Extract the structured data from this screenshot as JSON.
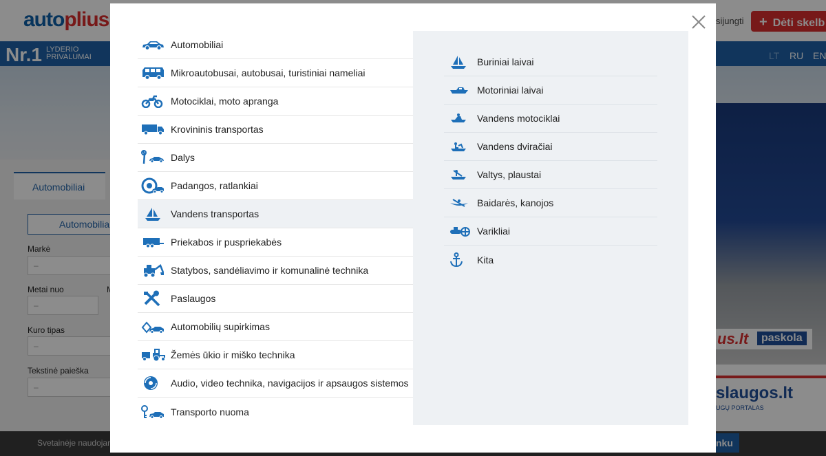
{
  "background": {
    "logo_part1": "auto",
    "logo_part2": "plius",
    "login_link": "sijungti",
    "add_ad_button": "Dėti skelb",
    "nr1": "Nr.1",
    "nr1_sub_line1": "LYDERIO",
    "nr1_sub_line2": "PRIVALUMAI",
    "languages": [
      "LT",
      "RU",
      "EN"
    ],
    "tab_automobiliai": "Automobiliai",
    "category_select": "Automobilia",
    "fields": {
      "marke_label": "Markė",
      "marke_value": "–",
      "metai_nuo_label": "Metai nuo",
      "metai_nuo_value": "–",
      "m_label": "M",
      "kuro_tipas_label": "Kuro tipas",
      "kuro_tipas_value": "–",
      "tekstine_paieska_label": "Tekstinė paieška",
      "tekstine_paieska_value": "–"
    },
    "promo_paskola_us": "us.lt",
    "promo_paskola_box": "paskola",
    "promo_paslaugos": "slaugos.lt",
    "promo_paslaugos_sub": "UGŲ PORTALAS",
    "cookie_text": "Svetainėje naudojan",
    "cookie_button": "nku"
  },
  "modal": {
    "categories": [
      {
        "label": "Automobiliai",
        "icon": "car-icon"
      },
      {
        "label": "Mikroautobusai, autobusai, turistiniai nameliai",
        "icon": "van-icon"
      },
      {
        "label": "Motociklai, moto apranga",
        "icon": "motorcycle-icon"
      },
      {
        "label": "Krovininis transportas",
        "icon": "truck-icon"
      },
      {
        "label": "Dalys",
        "icon": "parts-icon"
      },
      {
        "label": "Padangos, ratlankiai",
        "icon": "tire-icon"
      },
      {
        "label": "Vandens transportas",
        "icon": "sailboat-icon",
        "active": true
      },
      {
        "label": "Priekabos ir puspriekabės",
        "icon": "trailer-icon"
      },
      {
        "label": "Statybos, sandėliavimo ir komunalinė technika",
        "icon": "construction-icon"
      },
      {
        "label": "Paslaugos",
        "icon": "tools-icon"
      },
      {
        "label": "Automobilių supirkimas",
        "icon": "car-buyout-icon"
      },
      {
        "label": "Žemės ūkio ir miško technika",
        "icon": "tractor-icon"
      },
      {
        "label": "Audio, video technika, navigacijos ir apsaugos sistemos",
        "icon": "audio-icon"
      },
      {
        "label": "Transporto nuoma",
        "icon": "rental-icon"
      }
    ],
    "subcategories": [
      {
        "label": "Buriniai laivai",
        "icon": "sailboat-icon"
      },
      {
        "label": "Motoriniai laivai",
        "icon": "motorboat-icon"
      },
      {
        "label": "Vandens motociklai",
        "icon": "jetski-icon"
      },
      {
        "label": "Vandens dviračiai",
        "icon": "pedalo-icon"
      },
      {
        "label": "Valtys, plaustai",
        "icon": "rowboat-icon"
      },
      {
        "label": "Baidarės, kanojos",
        "icon": "canoe-icon"
      },
      {
        "label": "Varikliai",
        "icon": "engine-icon"
      },
      {
        "label": "Kita",
        "icon": "anchor-icon"
      }
    ]
  },
  "colors": {
    "accent": "#1f62a8",
    "icon": "#1e6fb8",
    "brand_red": "#d92f2f"
  }
}
